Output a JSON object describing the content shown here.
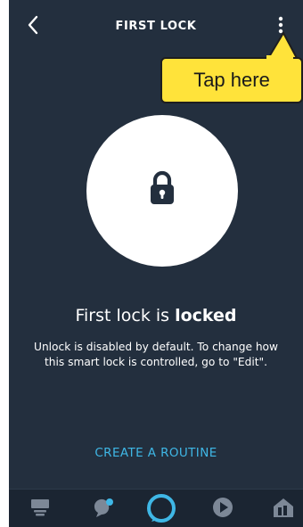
{
  "header": {
    "title": "FIRST LOCK",
    "back_icon": "chevron-left-icon",
    "more_icon": "vertical-ellipsis-icon"
  },
  "callout": {
    "text": "Tap here",
    "color": "#ffe33a"
  },
  "lock": {
    "icon": "lock-icon",
    "status_prefix": "First lock is ",
    "status_value": "locked",
    "info": "Unlock is disabled by default. To change how this smart lock is controlled, go to \"Edit\"."
  },
  "routine": {
    "label": "CREATE A ROUTINE",
    "color": "#3fb7e6"
  },
  "bottom_nav": {
    "items": [
      {
        "icon": "home-feed-icon"
      },
      {
        "icon": "communicate-icon"
      },
      {
        "icon": "alexa-icon"
      },
      {
        "icon": "play-icon"
      },
      {
        "icon": "devices-icon"
      }
    ]
  },
  "colors": {
    "background": "#232f3e",
    "accent": "#3fb7e6"
  }
}
